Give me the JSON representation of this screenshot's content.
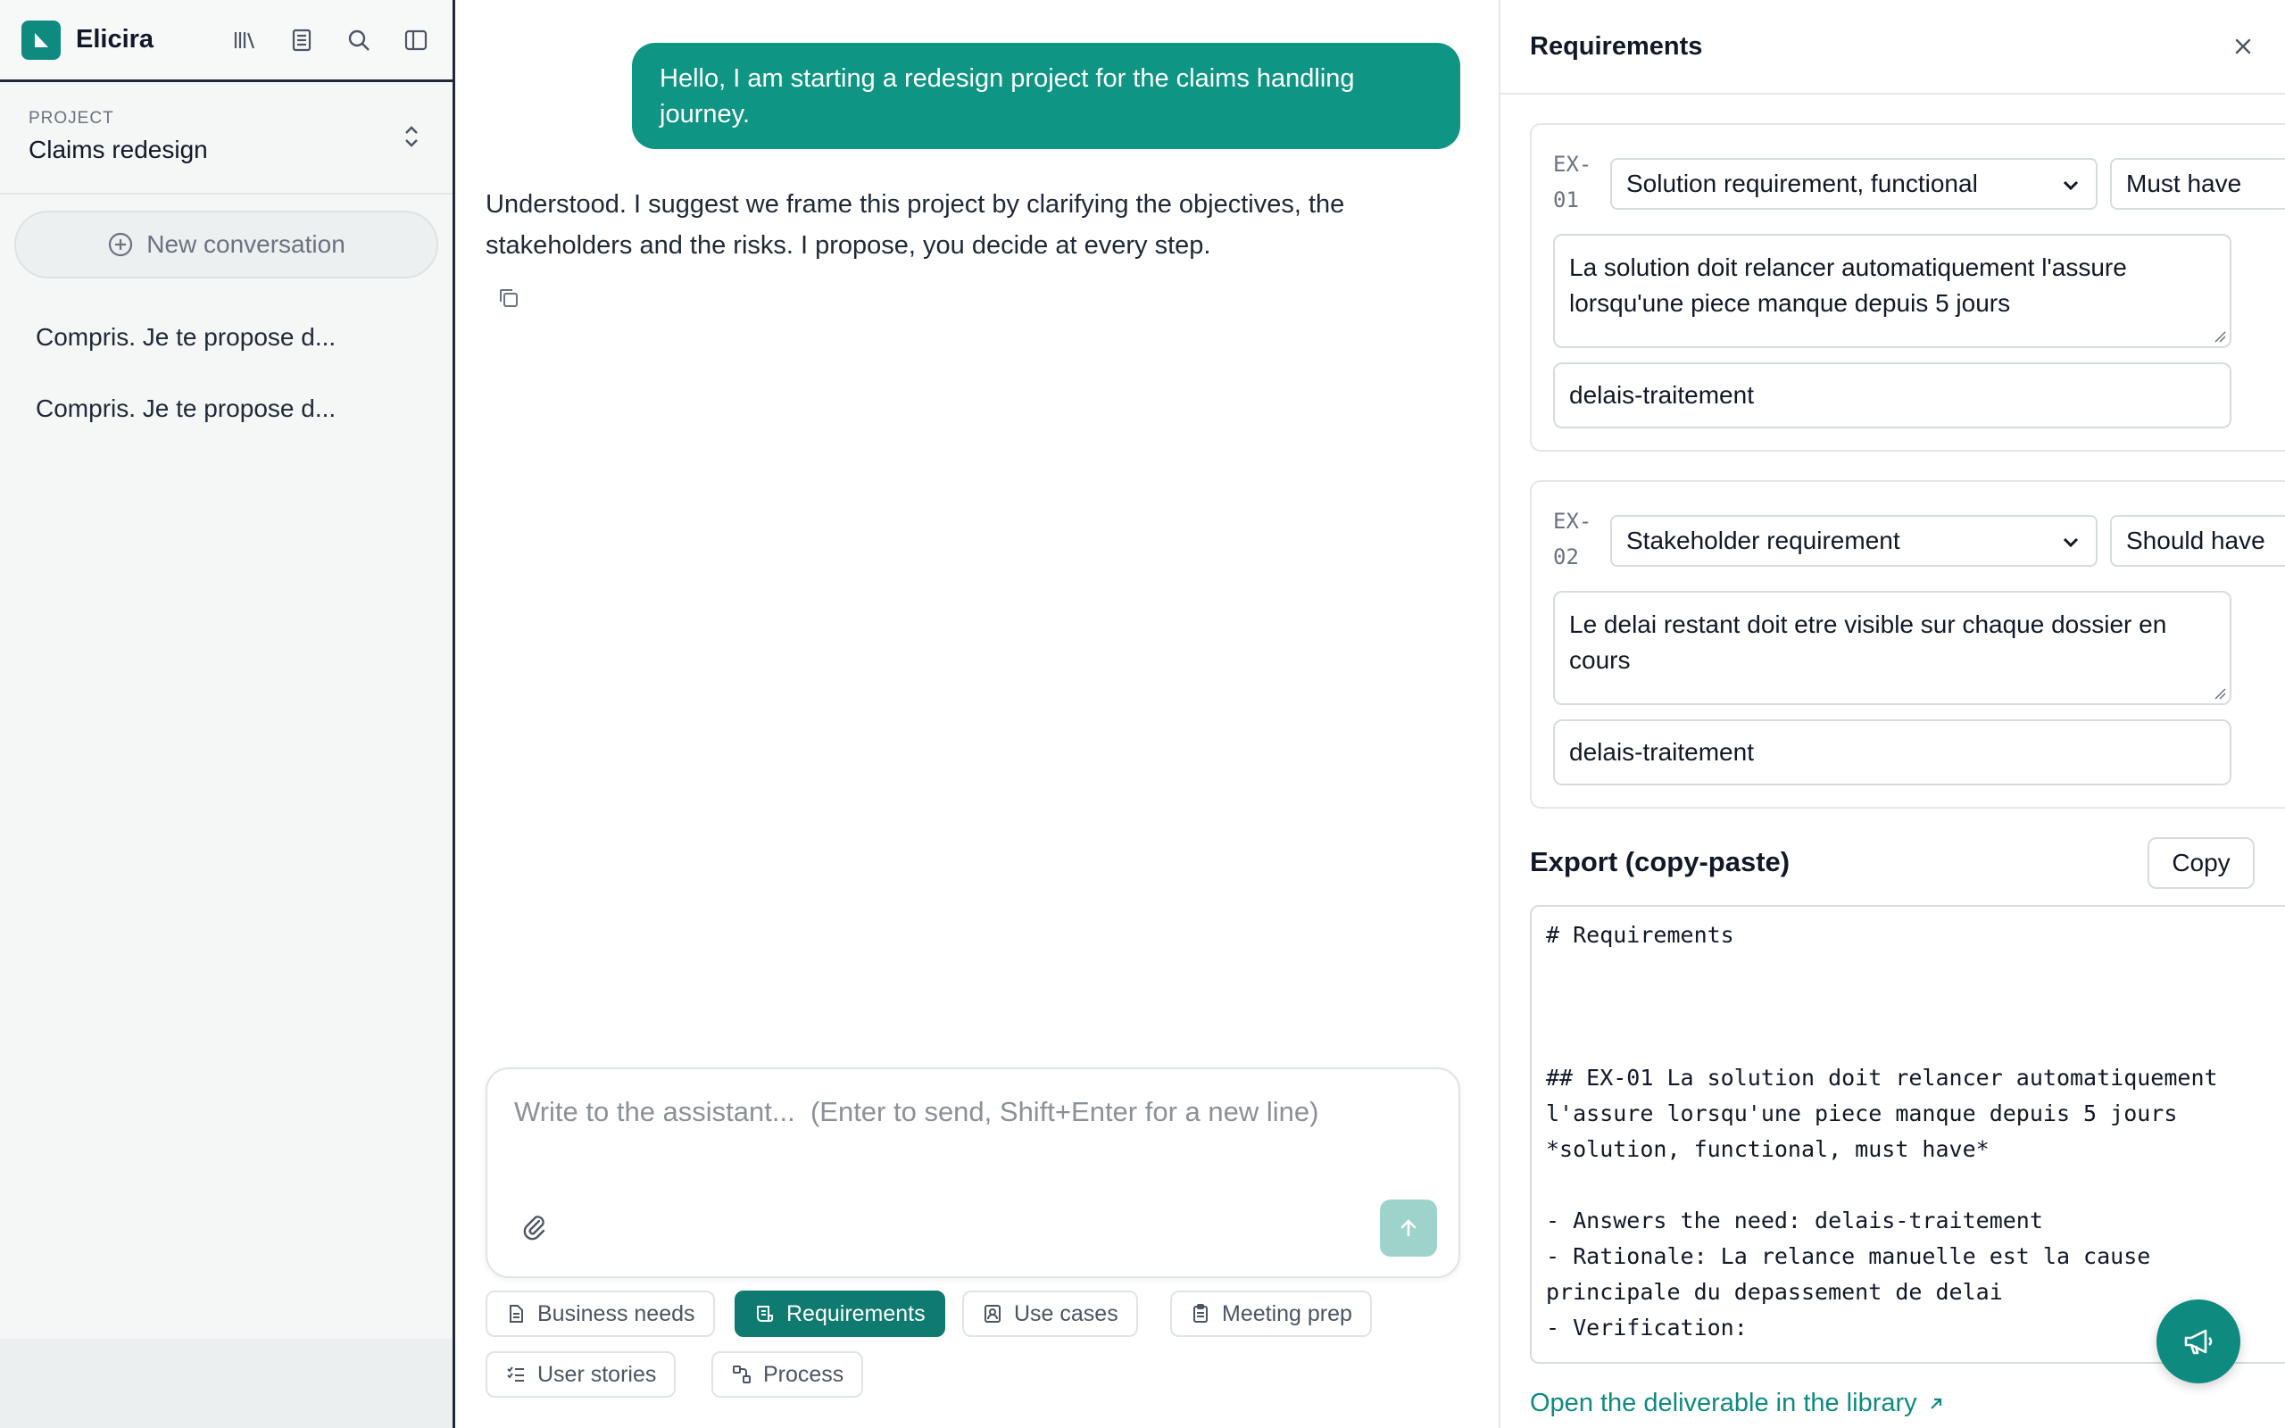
{
  "app": {
    "name": "Elicira",
    "accent": "#0f8a7f"
  },
  "sidebar": {
    "project_label": "PROJECT",
    "project_name": "Claims redesign",
    "new_conversation": "New conversation",
    "conversations": [
      {
        "label": "Compris. Je te propose d..."
      },
      {
        "label": "Compris. Je te propose d..."
      }
    ],
    "header_icons": [
      "library-icon",
      "document-icon",
      "search-icon",
      "sidebar-toggle-icon"
    ]
  },
  "chat": {
    "user_message": "Hello, I am starting a redesign project for the claims handling journey.",
    "assistant_message": "Understood. I suggest we frame this project by clarifying the objectives, the stakeholders and the risks. I propose, you decide at every step.",
    "composer_placeholder": "Write to the assistant...  (Enter to send, Shift+Enter for a new line)",
    "chips": [
      {
        "label": "Business needs",
        "icon": "document-icon",
        "active": false
      },
      {
        "label": "Requirements",
        "icon": "requirements-icon",
        "active": true
      },
      {
        "label": "Use cases",
        "icon": "user-card-icon",
        "active": false
      },
      {
        "label": "Meeting prep",
        "icon": "clipboard-icon",
        "active": false
      },
      {
        "label": "User stories",
        "icon": "checklist-icon",
        "active": false
      },
      {
        "label": "Process",
        "icon": "process-icon",
        "active": false
      }
    ]
  },
  "panel": {
    "title": "Requirements",
    "requirements": [
      {
        "id": "EX-01",
        "type": "Solution requirement, functional",
        "priority": "Must have",
        "text": "La solution doit relancer automatiquement l'assure lorsqu'une piece manque depuis 5 jours",
        "need": "delais-traitement"
      },
      {
        "id": "EX-02",
        "type": "Stakeholder requirement",
        "priority": "Should have",
        "text": "Le delai restant doit etre visible sur chaque dossier en cours",
        "need": "delais-traitement"
      }
    ],
    "export_title": "Export (copy-paste)",
    "export_copy": "Copy",
    "export_text": "# Requirements\n\n\n\n## EX-01 La solution doit relancer automatiquement l'assure lorsqu'une piece manque depuis 5 jours\n*solution, functional, must have*\n\n- Answers the need: delais-traitement\n- Rationale: La relance manuelle est la cause principale du depassement de delai\n- Verification:",
    "library_link": "Open the deliverable in the library"
  }
}
